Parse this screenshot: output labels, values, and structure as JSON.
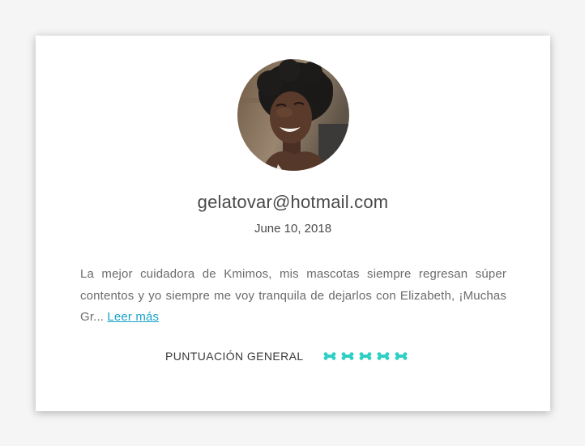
{
  "review": {
    "email": "gelatovar@hotmail.com",
    "date": "June 10, 2018",
    "text": "La mejor cuidadora de Kmimos, mis mascotas siempre regresan súper contentos y yo siempre me voy tranquila de dejarlos con Elizabeth, ¡Muchas Gr...",
    "read_more": "Leer más",
    "rating_label": "PUNTUACIÓN GENERAL",
    "rating_value": 5,
    "rating_max": 5
  },
  "colors": {
    "bone": "#2fd0c4",
    "link": "#1aa3c8"
  },
  "icons": {
    "rating": "dog-bone-icon"
  }
}
